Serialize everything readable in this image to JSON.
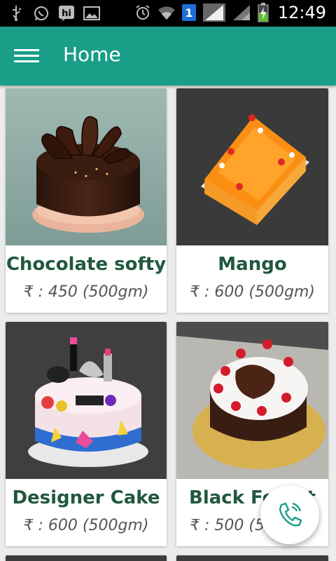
{
  "status_bar": {
    "time": "12:49",
    "sim_badge": "1",
    "icons": [
      "usb-icon",
      "whatsapp-icon",
      "hike-icon",
      "gallery-icon",
      "alarm-icon",
      "wifi-icon",
      "sim-icon",
      "signal-icon",
      "signal-icon-2",
      "battery-charging-icon"
    ]
  },
  "header": {
    "title": "Home",
    "menu_icon": "hamburger-menu-icon"
  },
  "products": [
    {
      "name": "Chocolate softy",
      "price": "₹ : 450 (500gm)"
    },
    {
      "name": "Mango",
      "price": "₹ : 600 (500gm)"
    },
    {
      "name": "Designer Cake",
      "price": "₹ : 600 (500gm)"
    },
    {
      "name": "Black Forest",
      "price": "₹ : 500 (500gm)"
    }
  ],
  "fab": {
    "icon": "phone-call-icon"
  },
  "colors": {
    "primary": "#1a9e87",
    "product_name": "#21583e",
    "background": "#ececec"
  }
}
